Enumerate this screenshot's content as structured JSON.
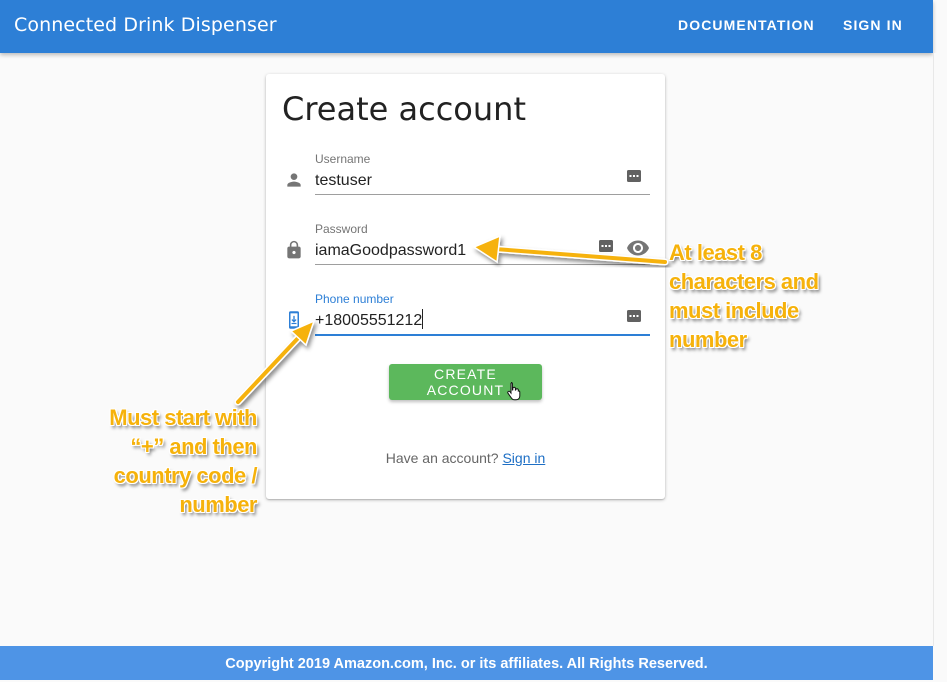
{
  "header": {
    "title": "Connected Drink Dispenser",
    "nav": [
      "DOCUMENTATION",
      "SIGN IN"
    ]
  },
  "card": {
    "title": "Create account",
    "username": {
      "label": "Username",
      "value": "testuser",
      "icon": "person-icon"
    },
    "password": {
      "label": "Password",
      "value": "iamaGoodpassword1",
      "icon": "lock-icon"
    },
    "phone": {
      "label": "Phone number",
      "value": "+18005551212",
      "icon": "phone-icon"
    },
    "create_button": "CREATE ACCOUNT",
    "have_account_text": "Have an account?",
    "signin_link": "Sign in"
  },
  "annotations": {
    "password_rule": [
      "At least 8",
      "characters and",
      "must include",
      "number"
    ],
    "phone_rule": [
      "Must start with",
      "“+” and then",
      "country code /",
      "number"
    ],
    "color": "#f6b20b"
  },
  "footer": {
    "text": "Copyright 2019 Amazon.com, Inc. or its affiliates. All Rights Reserved."
  },
  "colors": {
    "appbar": "#2d7fd6",
    "footer": "#4e94e6",
    "button": "#5cb85c",
    "focus": "#2d7fd6"
  }
}
